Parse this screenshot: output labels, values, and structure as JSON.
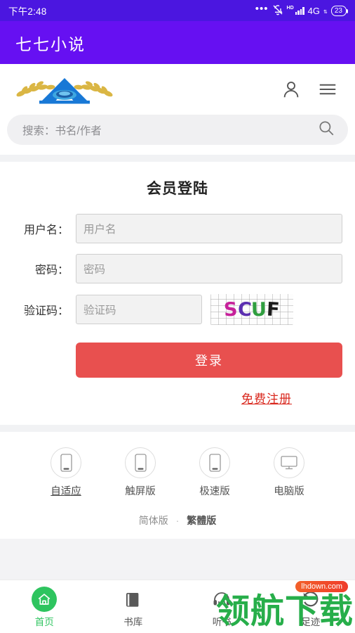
{
  "status_bar": {
    "time": "下午2:48",
    "dots": "•••",
    "mute_icon": "bell-off-icon",
    "hd_label": "HD",
    "network": "4G",
    "data_arrow": "⇅",
    "battery": "23"
  },
  "title_bar": {
    "title": "七七小说"
  },
  "header": {
    "logo_alt": "site-logo",
    "account_icon": "user-icon",
    "menu_icon": "hamburger-menu-icon"
  },
  "search": {
    "placeholder": "搜索：书名/作者",
    "value": "",
    "icon": "search-icon"
  },
  "login": {
    "heading": "会员登陆",
    "username": {
      "label": "用户名：",
      "placeholder": "用户名",
      "value": ""
    },
    "password": {
      "label": "密码：",
      "placeholder": "密码",
      "value": ""
    },
    "captcha": {
      "label": "验证码：",
      "placeholder": "验证码",
      "value": "",
      "image_text": "SCUF",
      "letters": [
        {
          "ch": "S",
          "color": "#c6219a"
        },
        {
          "ch": "C",
          "color": "#5b2fb0"
        },
        {
          "ch": "U",
          "color": "#2060c8"
        },
        {
          "ch": "F",
          "color": "#1b1b1b"
        }
      ]
    },
    "submit_label": "登录",
    "register_label": "免费注册",
    "accent_button_color": "#e8504f",
    "register_link_color": "#d9281e"
  },
  "versions": [
    {
      "label": "自适应",
      "icon": "mobile-phone-icon",
      "active": true
    },
    {
      "label": "触屏版",
      "icon": "mobile-phone-icon",
      "active": false
    },
    {
      "label": "极速版",
      "icon": "mobile-phone-icon",
      "active": false
    },
    {
      "label": "电脑版",
      "icon": "desktop-monitor-icon",
      "active": false
    }
  ],
  "language": {
    "simplified": "简体版",
    "separator": "·",
    "traditional": "繁體版"
  },
  "bottom_nav": [
    {
      "label": "首页",
      "icon": "home-icon",
      "active": true
    },
    {
      "label": "书库",
      "icon": "book-icon",
      "active": false
    },
    {
      "label": "听书",
      "icon": "headphones-icon",
      "active": false
    },
    {
      "label": "足迹",
      "icon": "history-rotate-left-icon",
      "active": false
    }
  ],
  "watermark": {
    "text": "领航下载",
    "badge": "lhdown.com",
    "color": "#27ae4a"
  },
  "colors": {
    "status_bar": "#4b16e0",
    "title_bar": "#6610f2",
    "accent_green": "#2ec45f",
    "accent_red": "#e8504f"
  }
}
